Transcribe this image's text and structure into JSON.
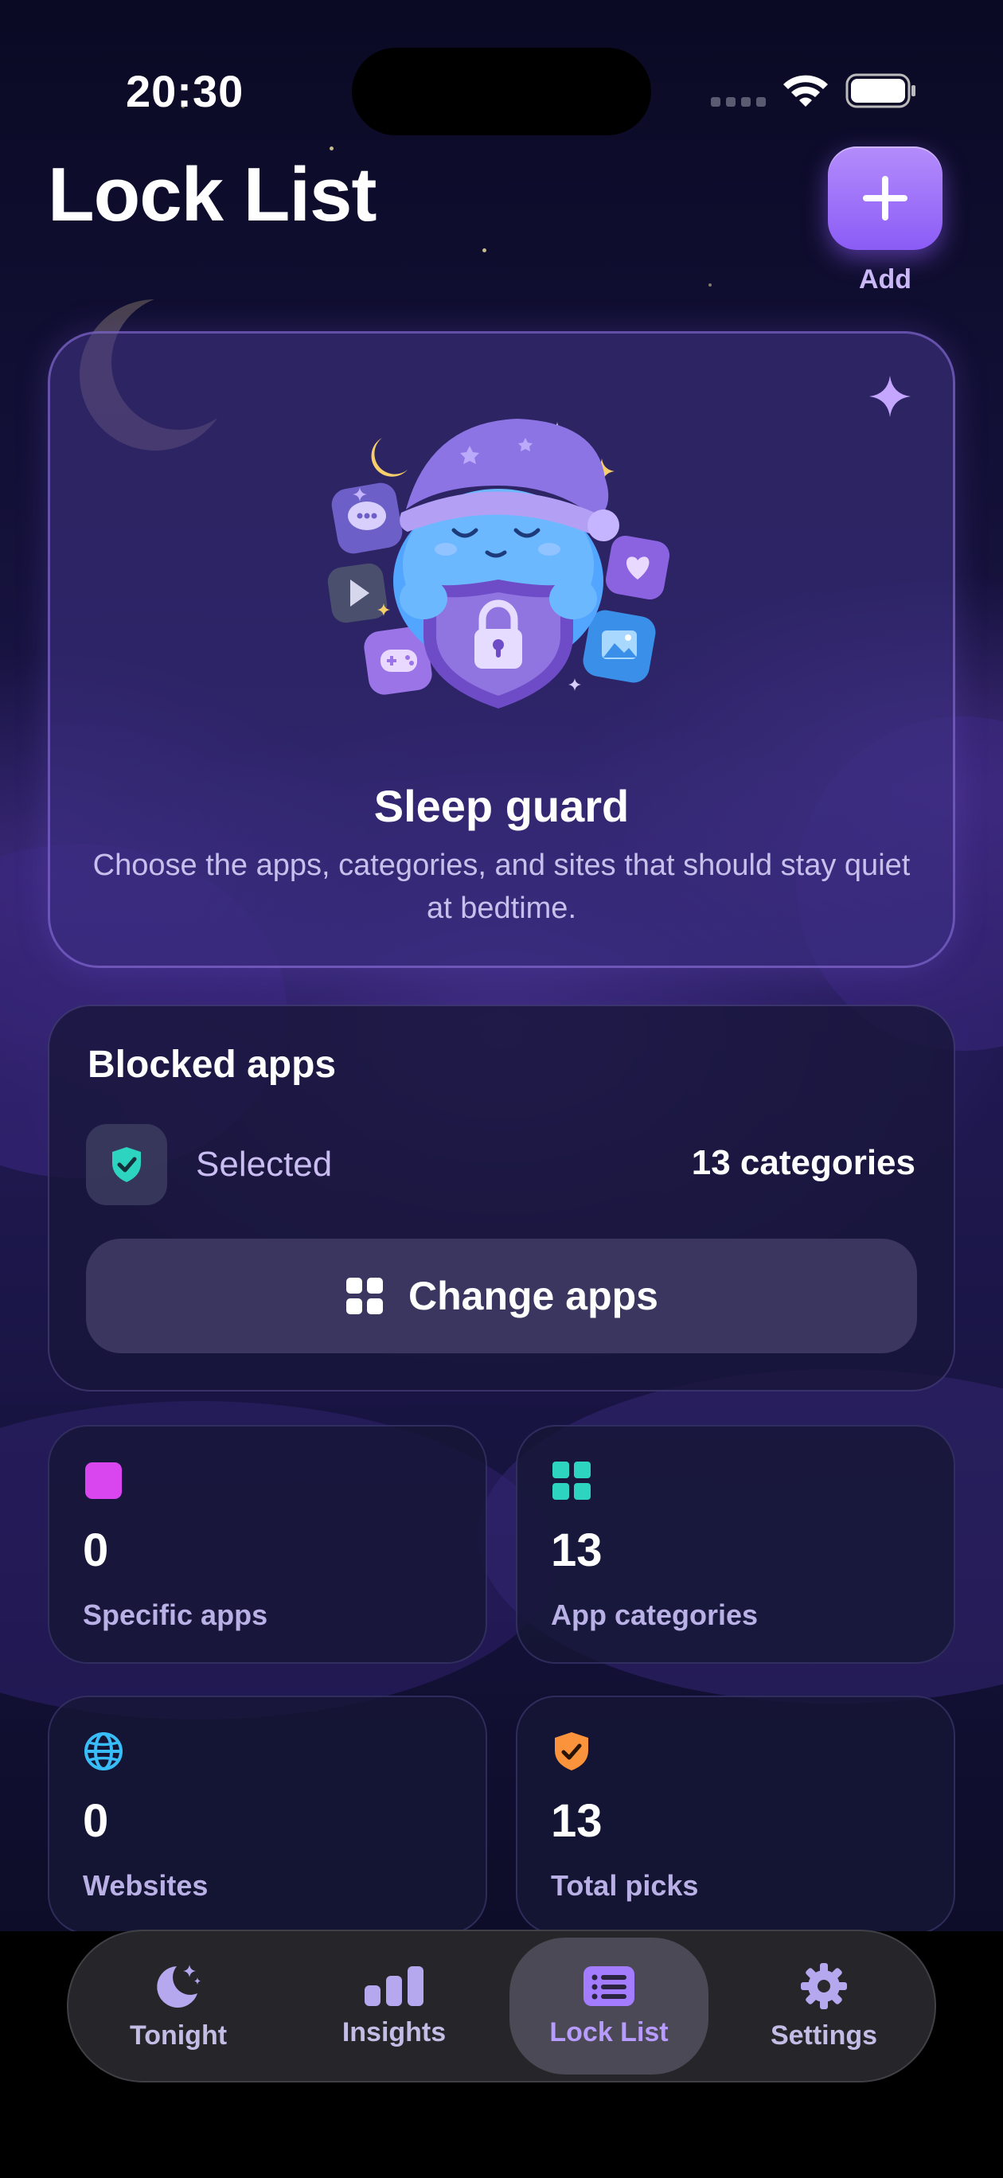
{
  "status_bar": {
    "time": "20:30"
  },
  "header": {
    "title": "Lock List",
    "add_label": "Add"
  },
  "hero": {
    "title": "Sleep guard",
    "subtitle": "Choose the apps, categories, and sites that should stay quiet at bedtime."
  },
  "blocked": {
    "title": "Blocked apps",
    "selected_label": "Selected",
    "selected_value": "13 categories",
    "change_button": "Change apps"
  },
  "stats": [
    {
      "value": "0",
      "label": "Specific apps",
      "icon": "app-square-icon",
      "color": "#d946ef"
    },
    {
      "value": "13",
      "label": "App categories",
      "icon": "grid-icon",
      "color": "#2dd4bf"
    },
    {
      "value": "0",
      "label": "Websites",
      "icon": "globe-icon",
      "color": "#38bdf8"
    },
    {
      "value": "13",
      "label": "Total picks",
      "icon": "check-shield-icon",
      "color": "#fb923c"
    }
  ],
  "tabs": [
    {
      "label": "Tonight",
      "icon": "moon-stars-icon",
      "active": false
    },
    {
      "label": "Insights",
      "icon": "bar-chart-icon",
      "active": false
    },
    {
      "label": "Lock List",
      "icon": "list-icon",
      "active": true
    },
    {
      "label": "Settings",
      "icon": "gear-icon",
      "active": false
    }
  ],
  "colors": {
    "accent": "#8b5cf6",
    "selected_check": "#2dd4bf"
  }
}
